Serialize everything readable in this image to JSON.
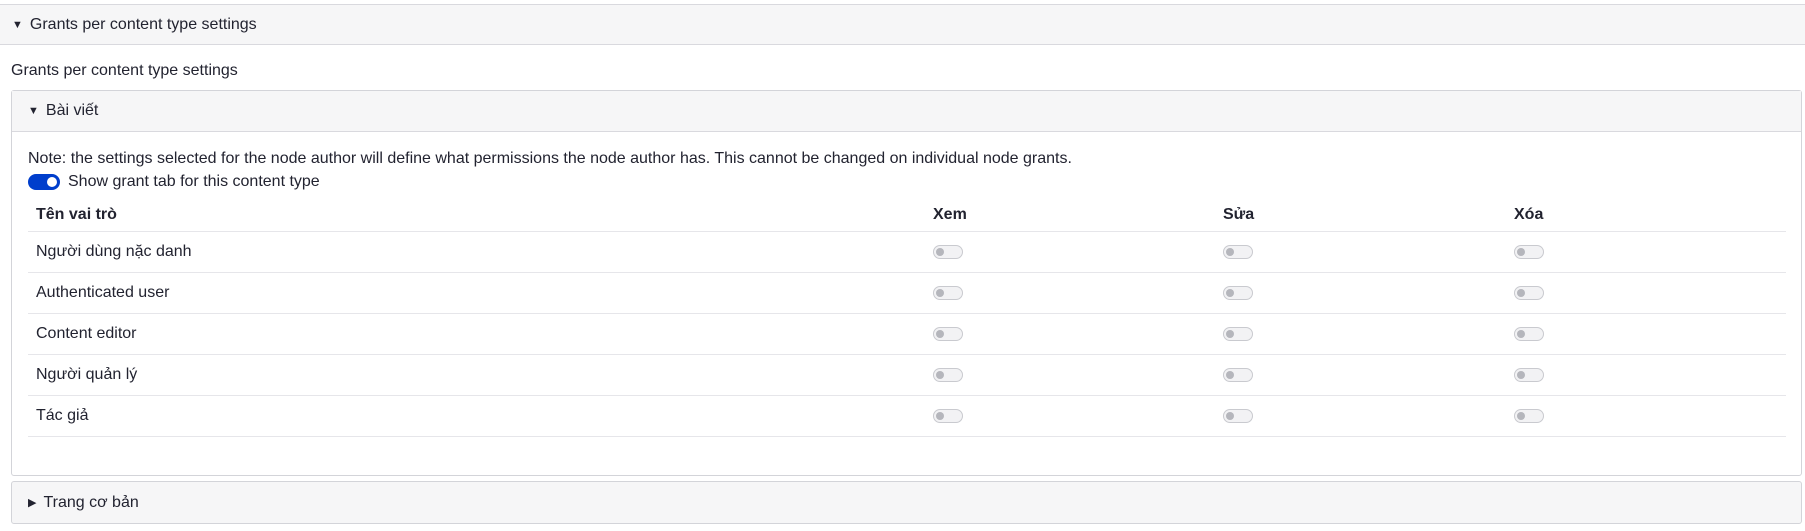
{
  "outer_details": {
    "summary_label": "Grants per content type settings",
    "expanded_icon": "triangle-down-icon"
  },
  "fieldset": {
    "legend": "Grants per content type settings"
  },
  "content_types": [
    {
      "label": "Bài viết",
      "expanded": true,
      "icon": "triangle-down-icon",
      "note": "Note: the settings selected for the node author will define what permissions the node author has. This cannot be changed on individual node grants.",
      "show_grant_tab": {
        "label": "Show grant tab for this content type",
        "checked": true
      },
      "table": {
        "headers": [
          "Tên vai trò",
          "Xem",
          "Sửa",
          "Xóa"
        ],
        "rows": [
          {
            "role": "Người dùng nặc danh",
            "view": false,
            "edit": false,
            "delete": false
          },
          {
            "role": "Authenticated user",
            "view": false,
            "edit": false,
            "delete": false
          },
          {
            "role": "Content editor",
            "view": false,
            "edit": false,
            "delete": false
          },
          {
            "role": "Người quản lý",
            "view": false,
            "edit": false,
            "delete": false
          },
          {
            "role": "Tác giả",
            "view": false,
            "edit": false,
            "delete": false
          }
        ]
      }
    },
    {
      "label": "Trang cơ bản",
      "expanded": false,
      "icon": "triangle-right-icon"
    }
  ],
  "colors": {
    "toggle_on": "#003ecc",
    "summary_bg": "#f6f6f7",
    "border": "#d3d4d9"
  }
}
